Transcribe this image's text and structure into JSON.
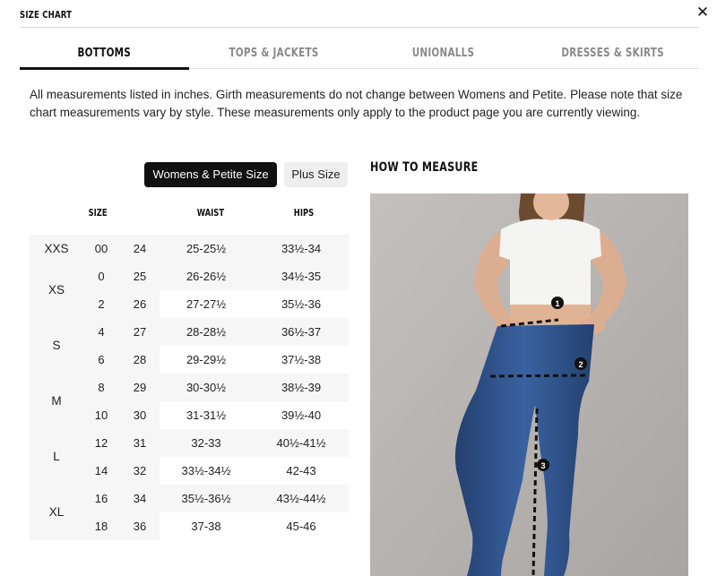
{
  "header": {
    "title": "SIZE CHART",
    "close_icon": "close-icon"
  },
  "tabs": [
    {
      "label": "BOTTOMS",
      "active": true
    },
    {
      "label": "TOPS & JACKETS",
      "active": false
    },
    {
      "label": "UNIONALLS",
      "active": false
    },
    {
      "label": "DRESSES & SKIRTS",
      "active": false
    }
  ],
  "intro_text": "All measurements listed in inches. Girth measurements do not change between Womens and Petite. Please note that size chart measurements vary by style. These measurements only apply to the product page you are currently viewing.",
  "toggle": {
    "active_label": "Womens & Petite Size",
    "inactive_label": "Plus Size"
  },
  "table": {
    "headers": {
      "size": "SIZE",
      "waist": "WAIST",
      "hips": "HIPS"
    },
    "groups": [
      {
        "label": "XXS",
        "rows": [
          {
            "size": "00",
            "num": "24",
            "waist": "25-25½",
            "hips": "33½-34"
          }
        ]
      },
      {
        "label": "XS",
        "rows": [
          {
            "size": "0",
            "num": "25",
            "waist": "26-26½",
            "hips": "34½-35"
          },
          {
            "size": "2",
            "num": "26",
            "waist": "27-27½",
            "hips": "35½-36"
          }
        ]
      },
      {
        "label": "S",
        "rows": [
          {
            "size": "4",
            "num": "27",
            "waist": "28-28½",
            "hips": "36½-37"
          },
          {
            "size": "6",
            "num": "28",
            "waist": "29-29½",
            "hips": "37½-38"
          }
        ]
      },
      {
        "label": "M",
        "rows": [
          {
            "size": "8",
            "num": "29",
            "waist": "30-30½",
            "hips": "38½-39"
          },
          {
            "size": "10",
            "num": "30",
            "waist": "31-31½",
            "hips": "39½-40"
          }
        ]
      },
      {
        "label": "L",
        "rows": [
          {
            "size": "12",
            "num": "31",
            "waist": "32-33",
            "hips": "40½-41½"
          },
          {
            "size": "14",
            "num": "32",
            "waist": "33½-34½",
            "hips": "42-43"
          }
        ]
      },
      {
        "label": "XL",
        "rows": [
          {
            "size": "16",
            "num": "34",
            "waist": "35½-36½",
            "hips": "43½-44½"
          },
          {
            "size": "18",
            "num": "36",
            "waist": "37-38",
            "hips": "45-46"
          }
        ]
      }
    ]
  },
  "how_to_measure": {
    "title": "HOW TO MEASURE",
    "markers": [
      "1",
      "2",
      "3"
    ]
  },
  "colors": {
    "accent": "#111111",
    "denim": "#2c4f86",
    "background": "#ffffff"
  }
}
